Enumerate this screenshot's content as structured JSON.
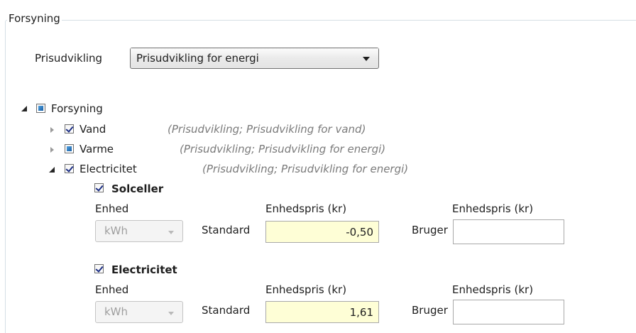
{
  "groupbox": {
    "title": "Forsyning"
  },
  "price_selector": {
    "label": "Prisudvikling",
    "value": "Prisudvikling for energi"
  },
  "tree": {
    "root": {
      "label": "Forsyning"
    },
    "items": [
      {
        "label": "Vand",
        "desc": "(Prisudvikling; Prisudvikling for vand)"
      },
      {
        "label": "Varme",
        "desc": "(Prisudvikling; Prisudvikling for energi)"
      },
      {
        "label": "Electricitet",
        "desc": "(Prisudvikling; Prisudvikling for energi)"
      }
    ],
    "subitems": [
      {
        "label": "Solceller",
        "unit_label": "Enhed",
        "unit_value": "kWh",
        "price_label": "Enhedspris (kr)",
        "standard_label": "Standard",
        "standard_value": "-0,50",
        "user_price_label": "Enhedspris (kr)",
        "user_label": "Bruger",
        "user_value": ""
      },
      {
        "label": "Electricitet",
        "unit_label": "Enhed",
        "unit_value": "kWh",
        "price_label": "Enhedspris (kr)",
        "standard_label": "Standard",
        "standard_value": "1,61",
        "user_price_label": "Enhedspris (kr)",
        "user_label": "Bruger",
        "user_value": ""
      }
    ]
  }
}
